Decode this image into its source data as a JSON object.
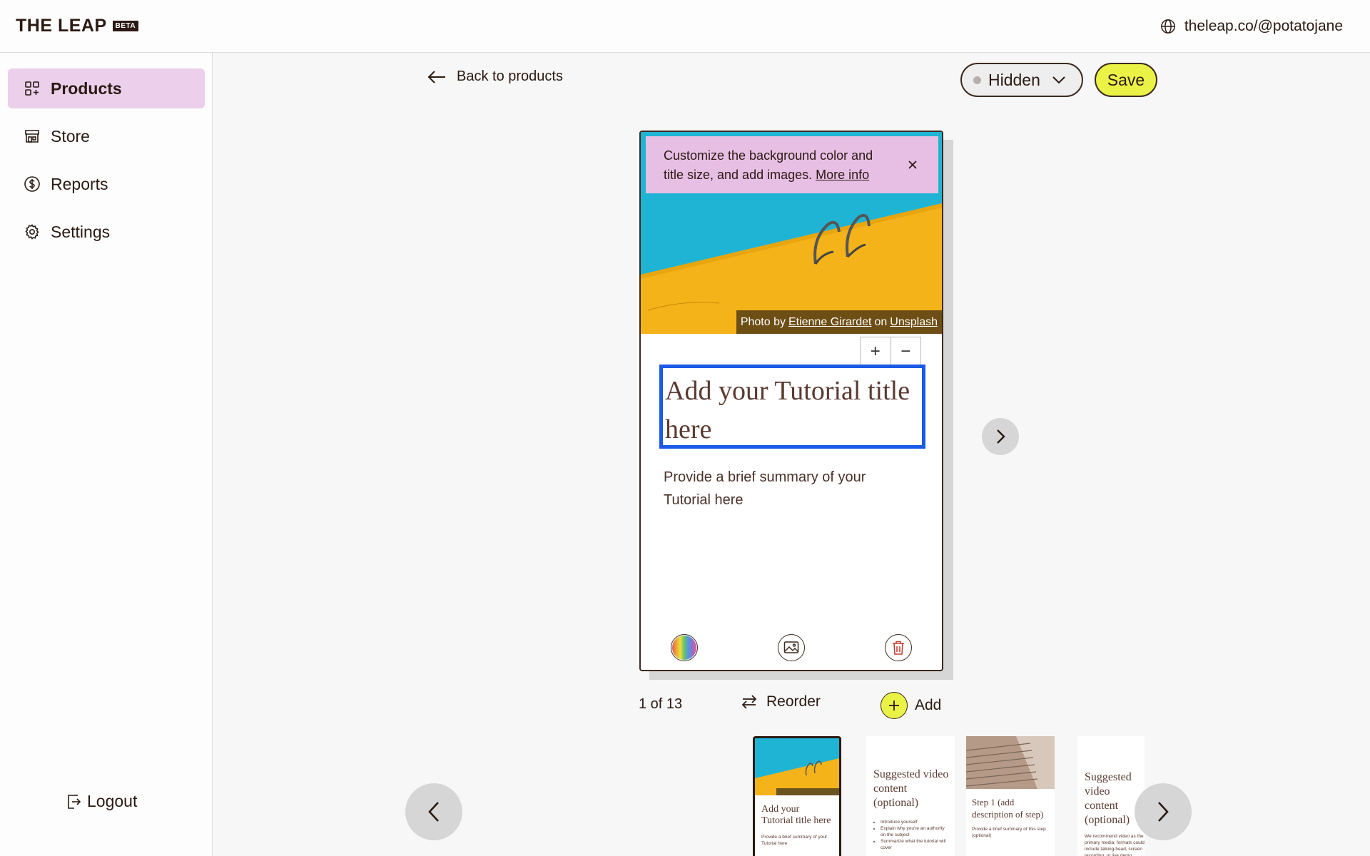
{
  "app": {
    "logo_text": "THE LEAP",
    "logo_badge": "BETA",
    "site_url": "theleap.co/@potatojane"
  },
  "sidebar": {
    "items": [
      {
        "label": "Products",
        "icon": "grid-plus-icon",
        "active": true
      },
      {
        "label": "Store",
        "icon": "store-icon",
        "active": false
      },
      {
        "label": "Reports",
        "icon": "dollar-circle-icon",
        "active": false
      },
      {
        "label": "Settings",
        "icon": "gear-icon",
        "active": false
      }
    ],
    "logout_label": "Logout"
  },
  "header": {
    "back_label": "Back to products",
    "status_value": "Hidden",
    "save_label": "Save"
  },
  "card": {
    "tip_text": "Customize the background color and title size, and add images. ",
    "tip_link": "More info",
    "credit_prefix": "Photo by",
    "credit_author": "Etienne Girardet",
    "credit_on": "on",
    "credit_site": "Unsplash",
    "size_plus": "+",
    "size_minus": "−",
    "title_placeholder": "Add your Tutorial title here",
    "summary_placeholder": "Provide a brief summary of your Tutorial here"
  },
  "footer": {
    "pager": "1 of 13",
    "reorder_label": "Reorder",
    "add_label": "Add"
  },
  "thumbnails": [
    {
      "title": "Add your Tutorial title here",
      "body": "Provide a brief summary of your Tutorial here",
      "selected": true
    },
    {
      "title": "Suggested video content (optional)",
      "bullets": [
        "Introduce yourself",
        "Explain why you're an authority on the subject",
        "Summarize what the tutorial will cover"
      ]
    },
    {
      "title": "Step 1 (add description of step)",
      "body": "Provide a brief summary of this step (optional)"
    },
    {
      "title": "Suggested video content (optional)",
      "body": "We recommend video as the primary media; formats could include talking-head, screen recording, or live demo."
    }
  ],
  "colors": {
    "accent_yellow": "#eaf246",
    "active_nav": "#ebcfeb",
    "tip_bg": "#e7bfe4",
    "focus_blue": "#1a5ae6",
    "text_brown": "#2b1a12"
  }
}
